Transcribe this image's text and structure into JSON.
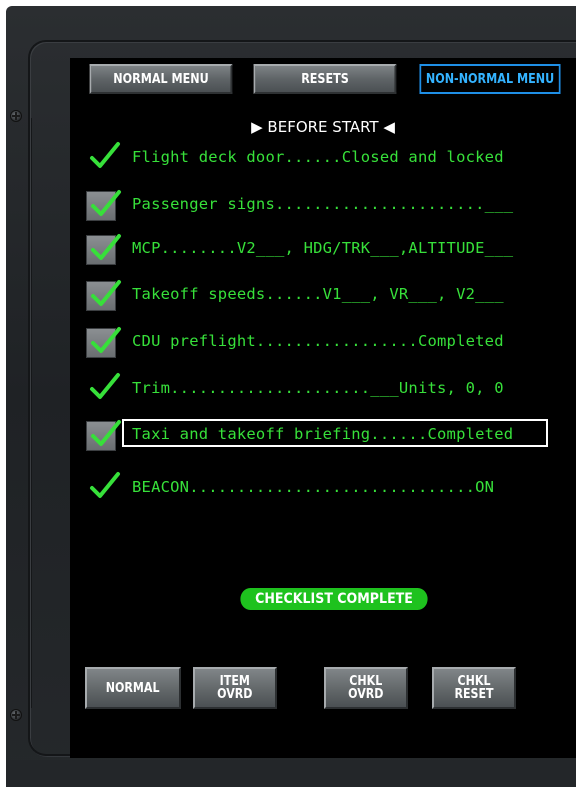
{
  "tabs": [
    {
      "label": "NORMAL MENU",
      "active": false
    },
    {
      "label": "RESETS",
      "active": false
    },
    {
      "label": "NON-NORMAL MENU",
      "active": true
    }
  ],
  "section_title": "BEFORE START",
  "items": [
    {
      "text": "Flight deck door......Closed and locked",
      "check": "plain"
    },
    {
      "text": "Passenger signs......................___",
      "check": "boxed"
    },
    {
      "text": "MCP........V2___, HDG/TRK___,ALTITUDE___",
      "check": "boxed"
    },
    {
      "text": "Takeoff speeds......V1___, VR___, V2___",
      "check": "boxed"
    },
    {
      "text": "CDU preflight.................Completed",
      "check": "boxed"
    },
    {
      "text": "Trim.....................___Units, 0, 0",
      "check": "plain"
    },
    {
      "text": "Taxi and takeoff briefing......Completed",
      "check": "boxed",
      "current": true
    },
    {
      "text": "BEACON..............................ON",
      "check": "plain"
    }
  ],
  "status": "CHECKLIST COMPLETE",
  "buttons": [
    {
      "label": "NORMAL"
    },
    {
      "label": "ITEM\nOVRD"
    },
    {
      "label": "CHKL\nOVRD"
    },
    {
      "label": "CHKL\nRESET"
    }
  ],
  "colors": {
    "checklist_text": "#37e03a",
    "active_tab_border": "#1f8fe6",
    "complete_pill": "#1ec21e"
  }
}
